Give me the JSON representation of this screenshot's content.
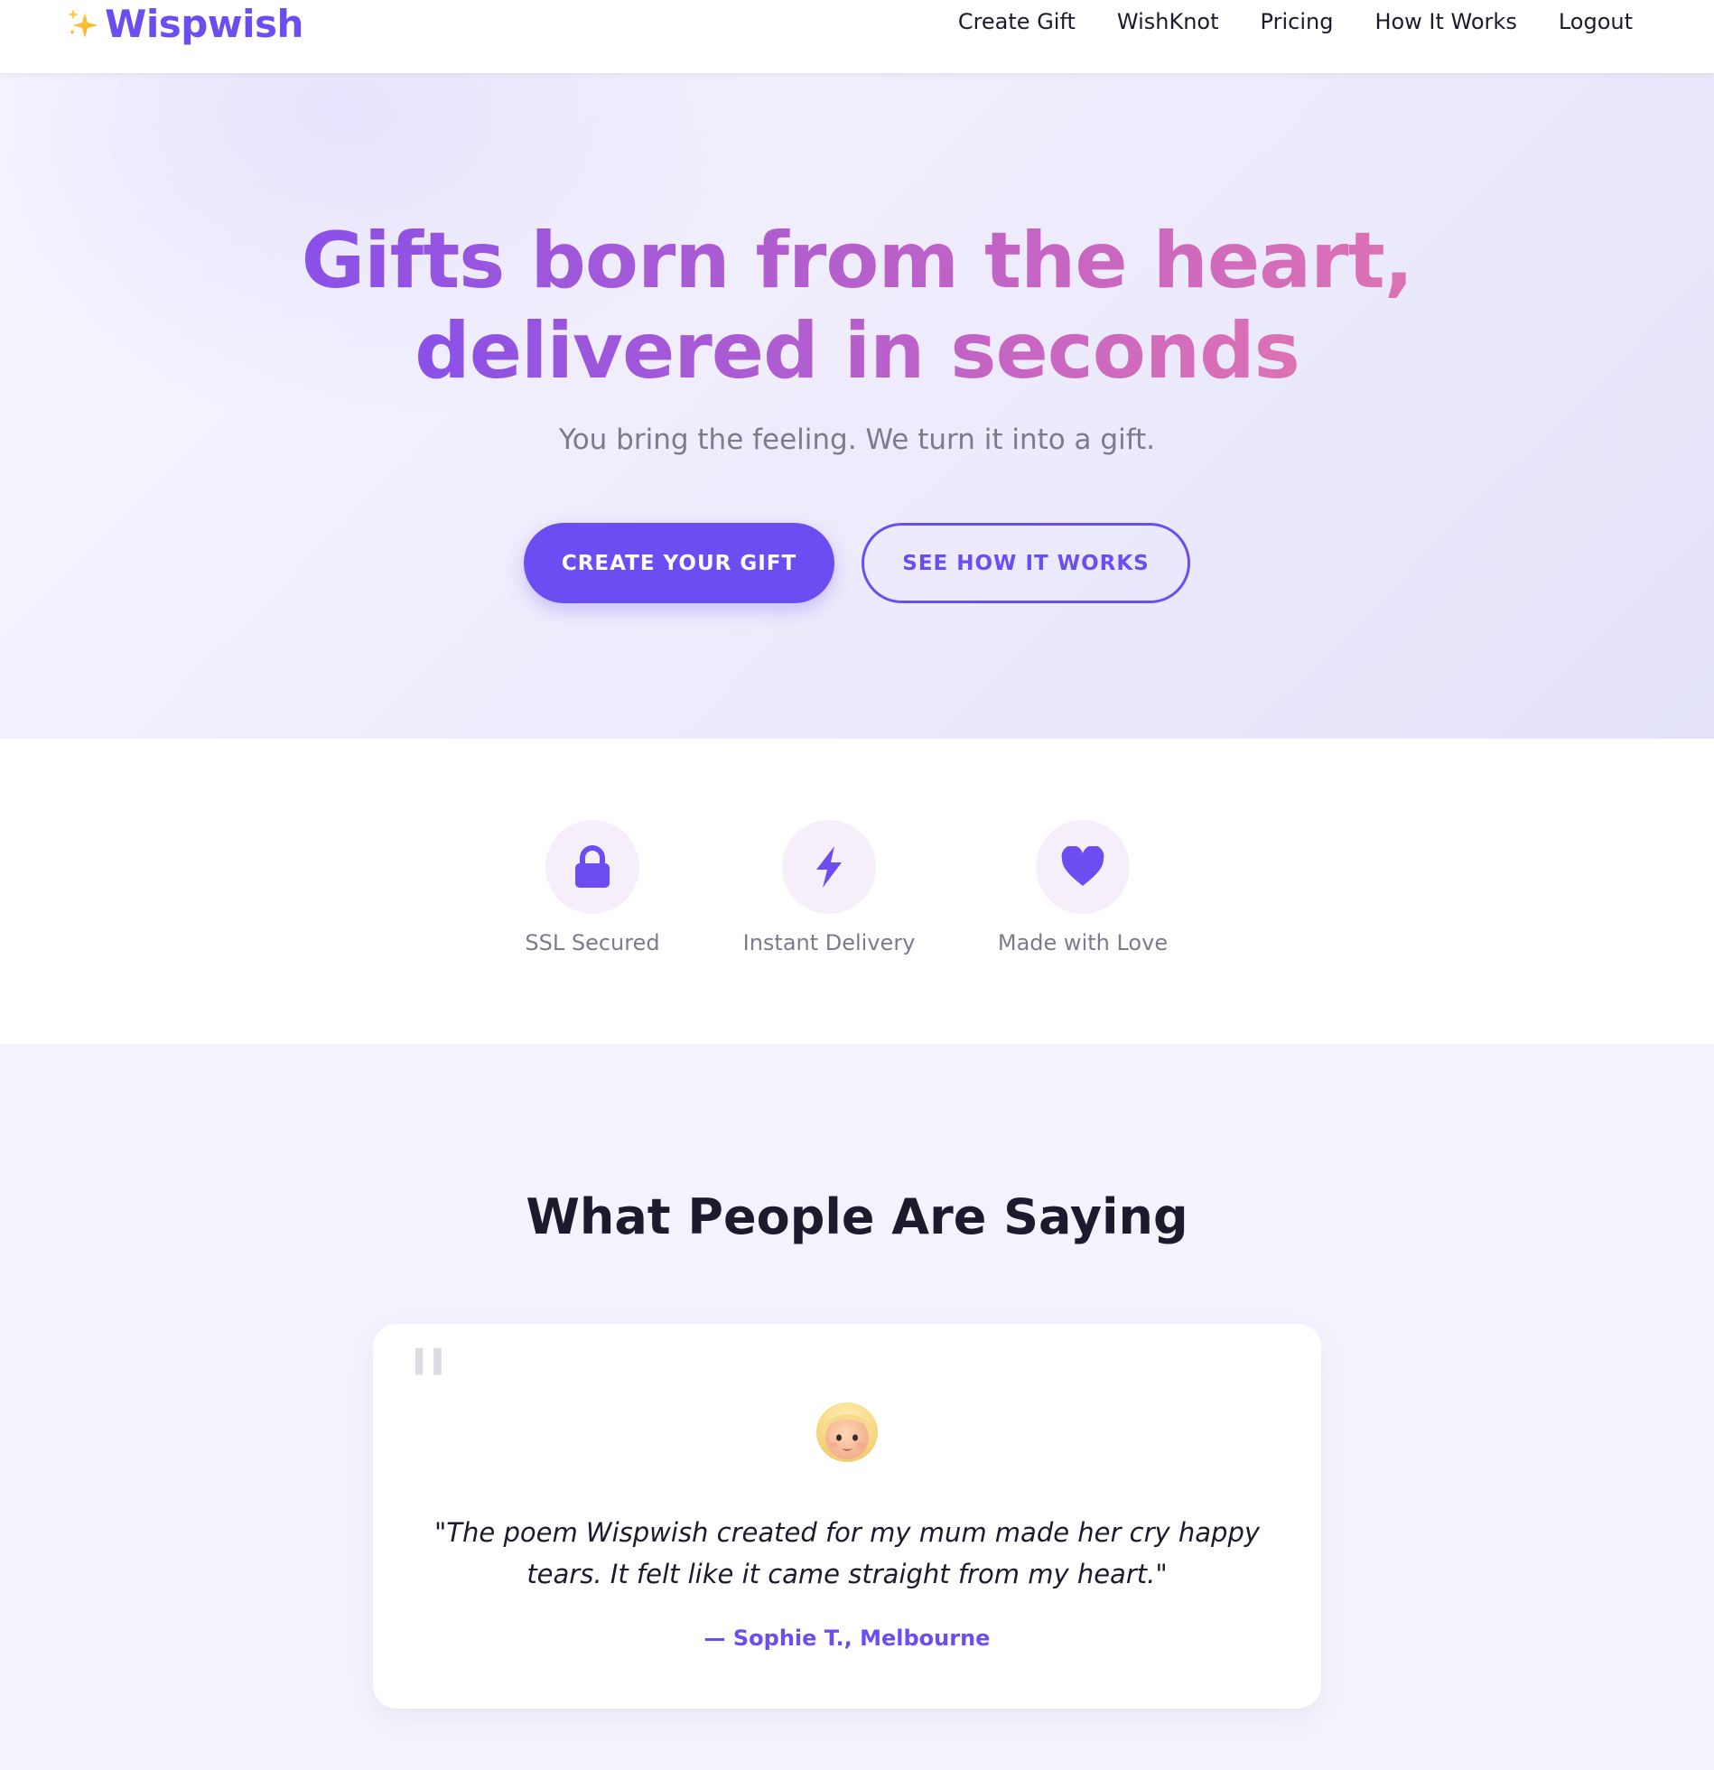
{
  "header": {
    "brand": "Wispwish",
    "brand_icon": "sparkles-icon",
    "nav": [
      "Create Gift",
      "WishKnot",
      "Pricing",
      "How It Works",
      "Logout"
    ]
  },
  "hero": {
    "title_line1": "Gifts born from the heart,",
    "title_line2": "delivered in seconds",
    "subtitle": "You bring the feeling. We turn it into a gift.",
    "primary_cta": "CREATE YOUR GIFT",
    "secondary_cta": "SEE HOW IT WORKS"
  },
  "trust": {
    "items": [
      {
        "label": "SSL Secured",
        "icon": "lock-icon"
      },
      {
        "label": "Instant Delivery",
        "icon": "lightning-icon"
      },
      {
        "label": "Made with Love",
        "icon": "heart-icon"
      }
    ]
  },
  "testimonials": {
    "title": "What People Are Saying",
    "quote_mark": "\"",
    "avatar_icon": "woman-avatar-icon",
    "quote": "\"The poem Wispwish created for my mum made her cry happy tears. It felt like it came straight from my heart.\"",
    "author": "— Sophie T., Melbourne"
  },
  "colors": {
    "accent": "#6c4df2",
    "gradient_start": "#8a50e8",
    "gradient_end": "#dd72b4",
    "muted_text": "#7d7a8d",
    "dark_text": "#1c1b2e",
    "page_bg": "#f4f3fd"
  }
}
